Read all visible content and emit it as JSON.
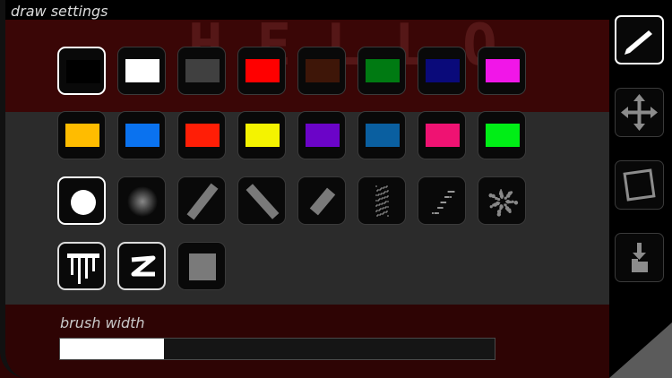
{
  "title": "draw settings",
  "background_text": "HELLO",
  "colors": [
    {
      "name": "black",
      "hex": "#000000",
      "selected": true
    },
    {
      "name": "white",
      "hex": "#ffffff"
    },
    {
      "name": "gray",
      "hex": "#404040"
    },
    {
      "name": "red",
      "hex": "#ff0000"
    },
    {
      "name": "brown",
      "hex": "#3e1608"
    },
    {
      "name": "green",
      "hex": "#007a12"
    },
    {
      "name": "navy",
      "hex": "#0a0a7a"
    },
    {
      "name": "magenta",
      "hex": "#f116e8"
    },
    {
      "name": "orange",
      "hex": "#ffbc00"
    },
    {
      "name": "blue",
      "hex": "#0a72ef"
    },
    {
      "name": "red-orange",
      "hex": "#ff1e06"
    },
    {
      "name": "yellow",
      "hex": "#f4f300"
    },
    {
      "name": "purple",
      "hex": "#6b04c8"
    },
    {
      "name": "steel-blue",
      "hex": "#0a5fa0"
    },
    {
      "name": "pink",
      "hex": "#ef1272"
    },
    {
      "name": "lime",
      "hex": "#00ee16"
    }
  ],
  "brushes": [
    {
      "name": "round-hard",
      "selected": true
    },
    {
      "name": "round-soft"
    },
    {
      "name": "chisel-diagonal-right"
    },
    {
      "name": "chisel-diagonal-left"
    },
    {
      "name": "chisel-small"
    },
    {
      "name": "spray-fine"
    },
    {
      "name": "spray-streak"
    },
    {
      "name": "splatter"
    },
    {
      "name": "drip"
    },
    {
      "name": "zigzag-marker"
    },
    {
      "name": "square"
    }
  ],
  "brush_width": {
    "label": "brush width",
    "value": 0.24
  },
  "sidebar": {
    "tools": [
      {
        "name": "pencil-tool",
        "icon": "pencil-icon",
        "active": true
      },
      {
        "name": "move-tool",
        "icon": "move-arrows-icon"
      },
      {
        "name": "canvas-tool",
        "icon": "canvas-frame-icon"
      },
      {
        "name": "save-tool",
        "icon": "download-folder-icon"
      }
    ]
  }
}
